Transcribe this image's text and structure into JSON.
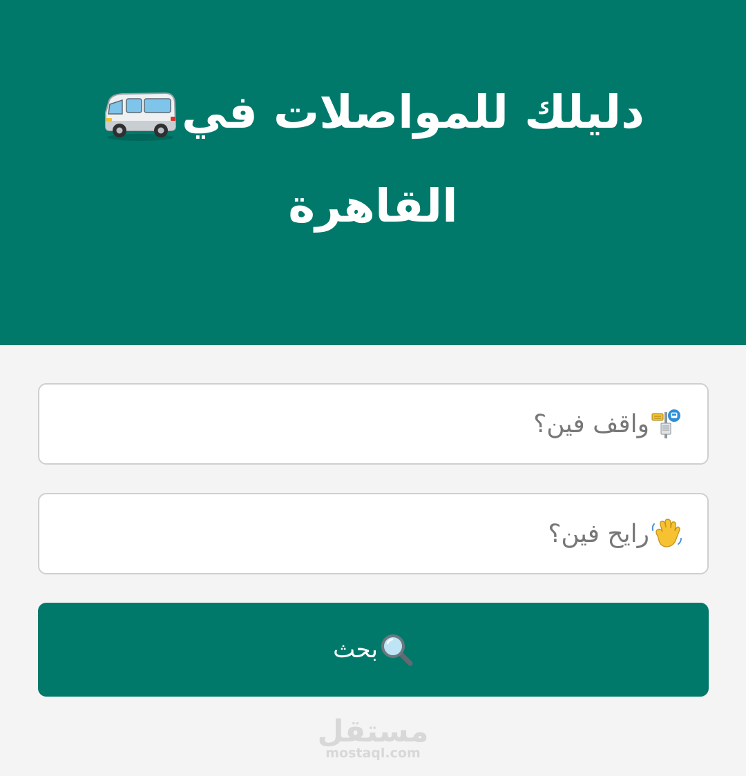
{
  "header": {
    "title_line1": "دليلك للمواصلات في",
    "title_line2": "القاهرة",
    "title_icon": "minibus-icon",
    "background_color": "#00796b"
  },
  "form": {
    "from": {
      "icon": "bus-stop-icon",
      "placeholder": "واقف فين؟"
    },
    "to": {
      "icon": "waving-hand-icon",
      "placeholder": "رايح فين؟"
    },
    "search_button": {
      "icon": "magnifying-glass-icon",
      "label": "بحث"
    }
  },
  "watermark": {
    "arabic": "مستقل",
    "latin": "mostaql.com"
  },
  "colors": {
    "accent": "#00796b",
    "page_background": "#f4f4f4",
    "field_border": "#cfcfcf",
    "placeholder_text": "#777777"
  }
}
